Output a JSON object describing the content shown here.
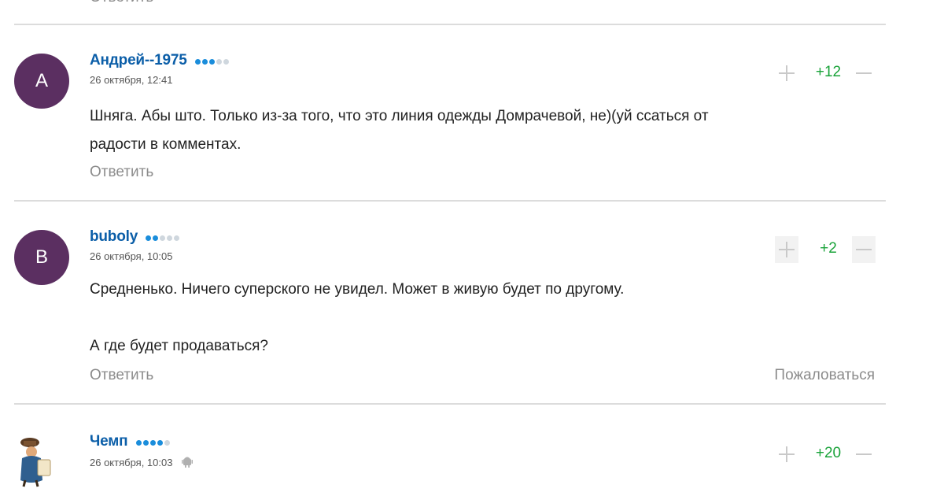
{
  "top": {
    "reply_label": "Ответить"
  },
  "comments": [
    {
      "avatar_letter": "А",
      "author": "Андрей--1975",
      "date": "26 октября, 12:41",
      "text_lines": [
        "Шняга. Абы што. Только из-за того, что это линия одежды Домрачевой, не)(уй ссаться от",
        "радости в комментах."
      ],
      "reply_label": "Ответить",
      "rating": "+12",
      "rating_level": 3
    },
    {
      "avatar_letter": "B",
      "author": "buboly",
      "date": "26 октября, 10:05",
      "text_lines": [
        "Средненько. Ничего суперского не увидел. Может в живую будет по другому.",
        "",
        "А где будет продаваться?"
      ],
      "reply_label": "Ответить",
      "complain_label": "Пожаловаться",
      "rating": "+2",
      "rating_level": 2
    },
    {
      "avatar_icon": "character-avatar-icon",
      "author": "Чемп",
      "date": "26 октября, 10:03",
      "rating": "+20",
      "rating_level": 4
    }
  ],
  "colors": {
    "author": "#0b5ea8",
    "rating": "#1aa33a",
    "avatar": "#5b2f61",
    "muted": "#8c8c8c"
  }
}
